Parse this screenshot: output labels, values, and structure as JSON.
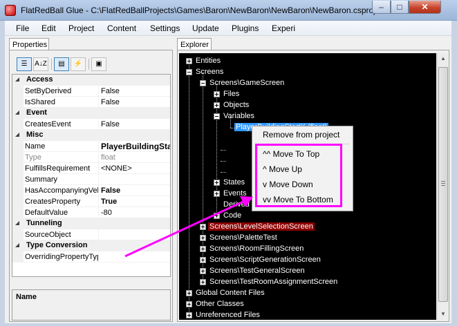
{
  "window": {
    "title": "FlatRedBall Glue - C:\\FlatRedBallProjects\\Games\\Baron\\NewBaron\\NewBaron\\NewBaron.csproj",
    "minimize_glyph": "–",
    "maximize_glyph": "□",
    "close_glyph": "✕"
  },
  "menubar": [
    "File",
    "Edit",
    "Project",
    "Content",
    "Settings",
    "Update",
    "Plugins",
    "Experi"
  ],
  "properties": {
    "tab_label": "Properties",
    "toolbar": {
      "categorized": "☰",
      "alphabetical": "A↓Z",
      "properties": "▤",
      "events": "⚡",
      "pages": "▣"
    },
    "categories": [
      {
        "label": "Access",
        "rows": [
          {
            "name": "SetByDerived",
            "value": "False"
          },
          {
            "name": "IsShared",
            "value": "False"
          }
        ]
      },
      {
        "label": "Event",
        "rows": [
          {
            "name": "CreatesEvent",
            "value": "False"
          }
        ]
      },
      {
        "label": "Misc",
        "rows": [
          {
            "name": "Name",
            "value": "PlayerBuildingStartX"
          },
          {
            "name": "Type",
            "value": "float"
          },
          {
            "name": "FulfillsRequirement",
            "value": "<NONE>"
          },
          {
            "name": "Summary",
            "value": ""
          },
          {
            "name": "HasAccompanyingVelocity",
            "value": "False"
          },
          {
            "name": "CreatesProperty",
            "value": "True"
          },
          {
            "name": "DefaultValue",
            "value": "-80"
          }
        ]
      },
      {
        "label": "Tunneling",
        "rows": [
          {
            "name": "SourceObject",
            "value": ""
          }
        ]
      },
      {
        "label": "Type Conversion",
        "rows": [
          {
            "name": "OverridingPropertyType",
            "value": ""
          }
        ]
      }
    ],
    "description_title": "Name"
  },
  "explorer": {
    "tab_label": "Explorer",
    "nodes": {
      "entities": "Entities",
      "screens": "Screens",
      "game_screen": "Screens\\GameScreen",
      "files": "Files",
      "objects": "Objects",
      "variables": "Variables",
      "selected_variable": "PlayerBuildingStartX (float)",
      "states": "States",
      "events": "Events",
      "derived": "Derived",
      "code": "Code",
      "level_selection": "Screens\\LevelSelectionScreen",
      "palette_test": "Screens\\PaletteTest",
      "room_filling": "Screens\\RoomFillingScreen",
      "script_generation": "Screens\\ScriptGenerationScreen",
      "test_general": "Screens\\TestGeneralScreen",
      "test_room_assignment": "Screens\\TestRoomAssignmentScreen",
      "global_content": "Global Content Files",
      "other_classes": "Other Classes",
      "unreferenced_files": "Unreferenced Files"
    }
  },
  "context_menu": {
    "remove": "Remove from project",
    "move_to_top": "^^ Move To Top",
    "move_up": "^ Move Up",
    "move_down": "v Move Down",
    "move_to_bottom": "vv Move To Bottom"
  },
  "colors": {
    "highlight": "#ff00ff",
    "tree_background": "#000000",
    "selected_screen": "#8b0000"
  }
}
